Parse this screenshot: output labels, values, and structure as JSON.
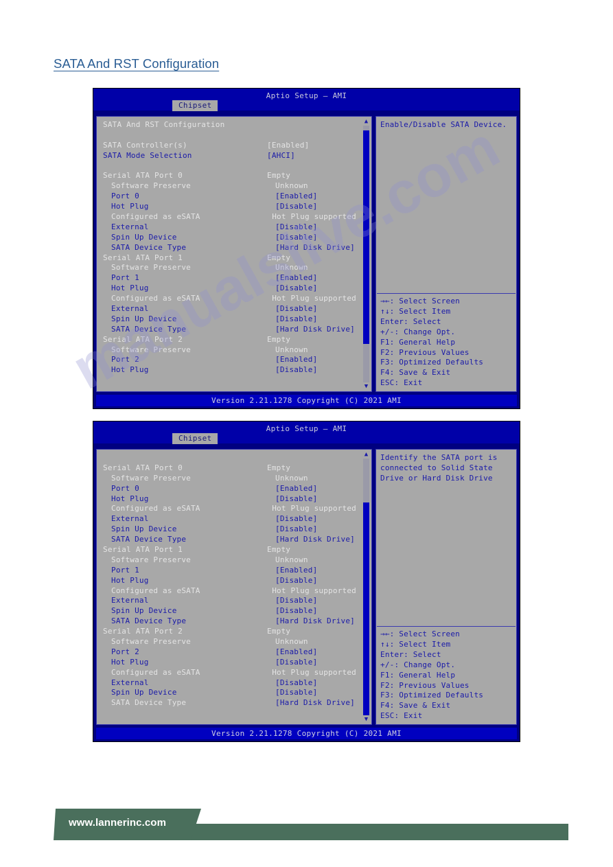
{
  "page": {
    "heading": "SATA And RST Configuration",
    "footer_url": "www.lannerinc.com"
  },
  "bios": {
    "title": "Aptio Setup – AMI",
    "tab": "Chipset",
    "version": "Version 2.21.1278 Copyright (C) 2021 AMI",
    "watermark": "manualslive.com",
    "keys": [
      "→←: Select Screen",
      "↑↓: Select Item",
      "Enter: Select",
      "+/-: Change Opt.",
      "F1: General Help",
      "F2: Previous Values",
      "F3: Optimized Defaults",
      "F4: Save & Exit",
      "ESC: Exit"
    ]
  },
  "screen1": {
    "help": "Enable/Disable SATA Device.",
    "scroll": {
      "thumb_top_pct": 2,
      "thumb_height_pct": 83
    },
    "rows": [
      {
        "label": "SATA And RST Configuration",
        "value": "",
        "style": "white",
        "indent": 0
      },
      {
        "label": "",
        "value": "",
        "style": "spacer",
        "indent": 0
      },
      {
        "label": "SATA Controller(s)",
        "value": "[Enabled]",
        "style": "white",
        "indent": 0
      },
      {
        "label": "SATA Mode Selection",
        "value": "[AHCI]",
        "style": "blue",
        "indent": 0
      },
      {
        "label": "",
        "value": "",
        "style": "spacer",
        "indent": 0
      },
      {
        "label": "Serial ATA Port 0",
        "value": "Empty",
        "style": "white",
        "indent": 0
      },
      {
        "label": "Software Preserve",
        "value": "Unknown",
        "style": "white",
        "indent": 1
      },
      {
        "label": "Port 0",
        "value": "[Enabled]",
        "style": "blue",
        "indent": 1
      },
      {
        "label": "Hot Plug",
        "value": "[Disable]",
        "style": "blue",
        "indent": 1
      },
      {
        "label": "Configured as eSATA",
        "value": "Hot Plug supported",
        "style": "white",
        "indent": 1
      },
      {
        "label": "External",
        "value": "[Disable]",
        "style": "blue",
        "indent": 1
      },
      {
        "label": "Spin Up Device",
        "value": "[Disable]",
        "style": "blue",
        "indent": 1
      },
      {
        "label": "SATA Device Type",
        "value": "[Hard Disk Drive]",
        "style": "blue",
        "indent": 1
      },
      {
        "label": "Serial ATA Port 1",
        "value": "Empty",
        "style": "white",
        "indent": 0
      },
      {
        "label": "Software Preserve",
        "value": "Unknown",
        "style": "white",
        "indent": 1
      },
      {
        "label": "Port 1",
        "value": "[Enabled]",
        "style": "blue",
        "indent": 1
      },
      {
        "label": "Hot Plug",
        "value": "[Disable]",
        "style": "blue",
        "indent": 1
      },
      {
        "label": "Configured as eSATA",
        "value": "Hot Plug supported",
        "style": "white",
        "indent": 1
      },
      {
        "label": "External",
        "value": "[Disable]",
        "style": "blue",
        "indent": 1
      },
      {
        "label": "Spin Up Device",
        "value": "[Disable]",
        "style": "blue",
        "indent": 1
      },
      {
        "label": "SATA Device Type",
        "value": "[Hard Disk Drive]",
        "style": "blue",
        "indent": 1
      },
      {
        "label": "Serial ATA Port 2",
        "value": "Empty",
        "style": "white",
        "indent": 0
      },
      {
        "label": "Software Preserve",
        "value": "Unknown",
        "style": "white",
        "indent": 1
      },
      {
        "label": "Port 2",
        "value": "[Enabled]",
        "style": "blue",
        "indent": 1
      },
      {
        "label": "Hot Plug",
        "value": "[Disable]",
        "style": "blue",
        "indent": 1
      }
    ]
  },
  "screen2": {
    "help": "Identify the SATA port is connected to Solid State Drive or Hard Disk Drive",
    "scroll": {
      "thumb_top_pct": 17,
      "thumb_height_pct": 83
    },
    "rows": [
      {
        "label": "",
        "value": "",
        "style": "spacer",
        "indent": 0
      },
      {
        "label": "Serial ATA Port 0",
        "value": "Empty",
        "style": "white",
        "indent": 0
      },
      {
        "label": "Software Preserve",
        "value": "Unknown",
        "style": "white",
        "indent": 1
      },
      {
        "label": "Port 0",
        "value": "[Enabled]",
        "style": "blue",
        "indent": 1
      },
      {
        "label": "Hot Plug",
        "value": "[Disable]",
        "style": "blue",
        "indent": 1
      },
      {
        "label": "Configured as eSATA",
        "value": "Hot Plug supported",
        "style": "white",
        "indent": 1
      },
      {
        "label": "External",
        "value": "[Disable]",
        "style": "blue",
        "indent": 1
      },
      {
        "label": "Spin Up Device",
        "value": "[Disable]",
        "style": "blue",
        "indent": 1
      },
      {
        "label": "SATA Device Type",
        "value": "[Hard Disk Drive]",
        "style": "blue",
        "indent": 1
      },
      {
        "label": "Serial ATA Port 1",
        "value": "Empty",
        "style": "white",
        "indent": 0
      },
      {
        "label": "Software Preserve",
        "value": "Unknown",
        "style": "white",
        "indent": 1
      },
      {
        "label": "Port 1",
        "value": "[Enabled]",
        "style": "blue",
        "indent": 1
      },
      {
        "label": "Hot Plug",
        "value": "[Disable]",
        "style": "blue",
        "indent": 1
      },
      {
        "label": "Configured as eSATA",
        "value": "Hot Plug supported",
        "style": "white",
        "indent": 1
      },
      {
        "label": "External",
        "value": "[Disable]",
        "style": "blue",
        "indent": 1
      },
      {
        "label": "Spin Up Device",
        "value": "[Disable]",
        "style": "blue",
        "indent": 1
      },
      {
        "label": "SATA Device Type",
        "value": "[Hard Disk Drive]",
        "style": "blue",
        "indent": 1
      },
      {
        "label": "Serial ATA Port 2",
        "value": "Empty",
        "style": "white",
        "indent": 0
      },
      {
        "label": "Software Preserve",
        "value": "Unknown",
        "style": "white",
        "indent": 1
      },
      {
        "label": "Port 2",
        "value": "[Enabled]",
        "style": "blue",
        "indent": 1
      },
      {
        "label": "Hot Plug",
        "value": "[Disable]",
        "style": "blue",
        "indent": 1
      },
      {
        "label": "Configured as eSATA",
        "value": "Hot Plug supported",
        "style": "white",
        "indent": 1
      },
      {
        "label": "External",
        "value": "[Disable]",
        "style": "blue",
        "indent": 1
      },
      {
        "label": "Spin Up Device",
        "value": "[Disable]",
        "style": "blue",
        "indent": 1
      },
      {
        "label": "SATA Device Type",
        "value": "[Hard Disk Drive]",
        "style": "selected",
        "indent": 1
      }
    ]
  }
}
